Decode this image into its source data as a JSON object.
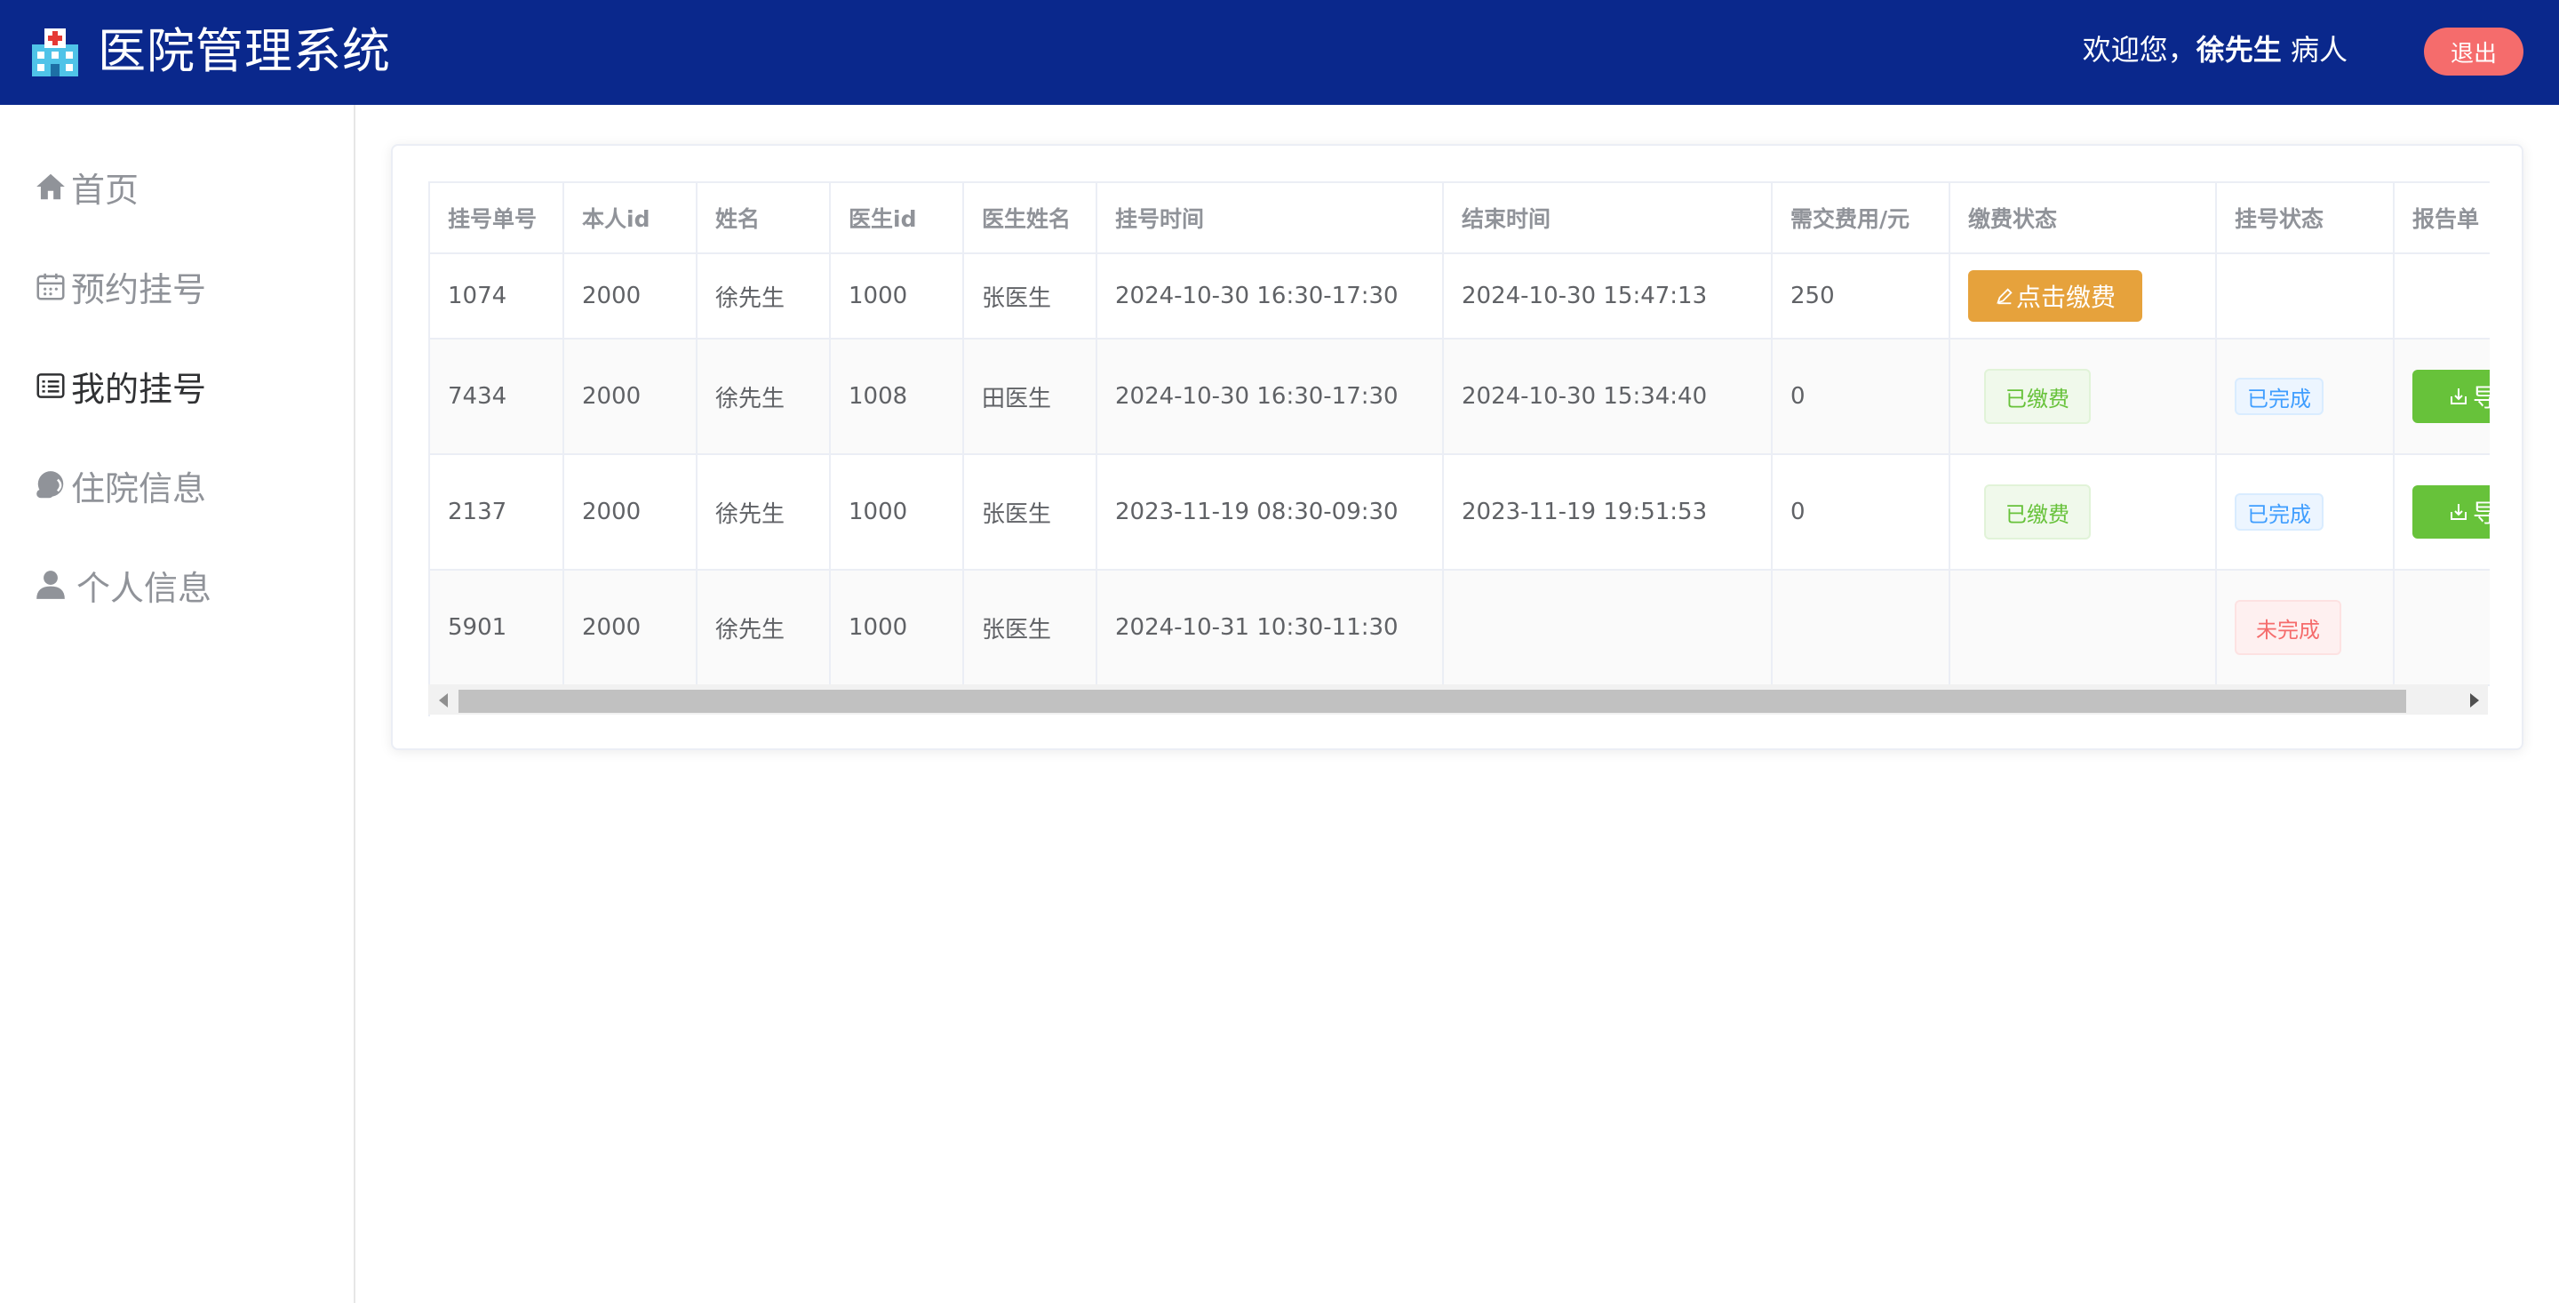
{
  "header": {
    "title": "医院管理系统",
    "welcome_prefix": "欢迎您，",
    "user_name": "徐先生",
    "role": "病人",
    "logout_label": "退出",
    "logo_icon": "hospital-icon"
  },
  "sidebar": {
    "items": [
      {
        "label": "首页",
        "icon": "home-icon"
      },
      {
        "label": "预约挂号",
        "icon": "calendar-icon"
      },
      {
        "label": "我的挂号",
        "icon": "list-icon",
        "active": true
      },
      {
        "label": "住院信息",
        "icon": "bed-icon"
      },
      {
        "label": "个人信息",
        "icon": "user-icon"
      }
    ]
  },
  "table": {
    "columns": [
      "挂号单号",
      "本人id",
      "姓名",
      "医生id",
      "医生姓名",
      "挂号时间",
      "结束时间",
      "需交费用/元",
      "缴费状态",
      "挂号状态",
      "报告单"
    ],
    "rows": [
      {
        "id": "1074",
        "self_id": "2000",
        "name": "徐先生",
        "doctor_id": "1000",
        "doctor_name": "张医生",
        "reg_time": "2024-10-30 16:30-17:30",
        "end_time": "2024-10-30 15:47:13",
        "fee": "250",
        "pay_status": "点击缴费",
        "reg_status": "",
        "report": ""
      },
      {
        "id": "7434",
        "self_id": "2000",
        "name": "徐先生",
        "doctor_id": "1008",
        "doctor_name": "田医生",
        "reg_time": "2024-10-30 16:30-17:30",
        "end_time": "2024-10-30 15:34:40",
        "fee": "0",
        "pay_status": "已缴费",
        "reg_status": "已完成",
        "report": "导"
      },
      {
        "id": "2137",
        "self_id": "2000",
        "name": "徐先生",
        "doctor_id": "1000",
        "doctor_name": "张医生",
        "reg_time": "2023-11-19 08:30-09:30",
        "end_time": "2023-11-19 19:51:53",
        "fee": "0",
        "pay_status": "已缴费",
        "reg_status": "已完成",
        "report": "导"
      },
      {
        "id": "5901",
        "self_id": "2000",
        "name": "徐先生",
        "doctor_id": "1000",
        "doctor_name": "张医生",
        "reg_time": "2024-10-31 10:30-11:30",
        "end_time": "",
        "fee": "",
        "pay_status": "",
        "reg_status": "未完成",
        "report": ""
      }
    ]
  },
  "colors": {
    "header_bg": "#0a288c",
    "logout_bg": "#f56c6c",
    "pay_button": "#e6a23c",
    "export_button": "#67c23a",
    "tag_done": "#409eff",
    "tag_undone": "#f56c6c"
  }
}
